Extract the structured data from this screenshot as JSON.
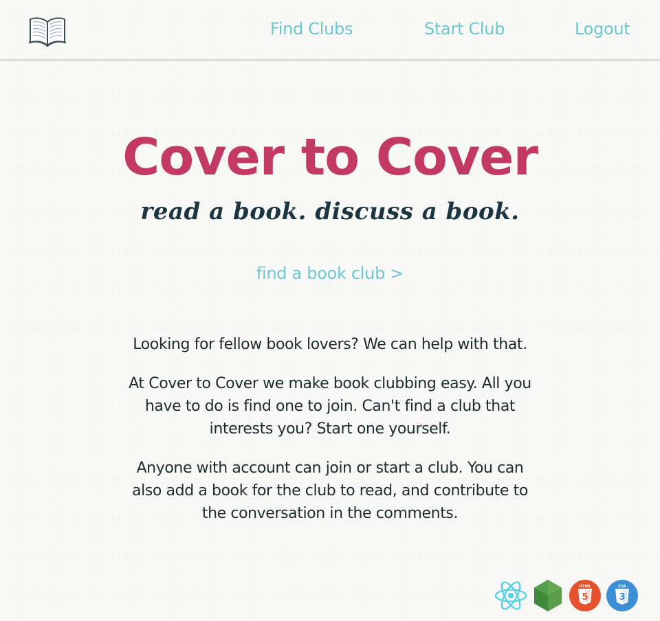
{
  "header": {
    "logo_icon": "open-book-icon",
    "nav": {
      "find_clubs": "Find Clubs",
      "start_club": "Start Club",
      "logout": "Logout"
    }
  },
  "hero": {
    "title": "Cover to Cover",
    "tagline": "read a book. discuss a book.",
    "cta": "find a book club >"
  },
  "about": {
    "paragraphs": [
      "Looking for fellow book lovers? We can help with that.",
      "At Cover to Cover we make book clubbing easy. All you have to do is find one to join. Can't find a club that interests you? Start one yourself.",
      "Anyone with account can join or start a club. You can also add a book for the club to read, and contribute to the conversation in the comments."
    ]
  },
  "footer": {
    "tech_icons": [
      "react-icon",
      "nodejs-icon",
      "html5-icon",
      "css3-icon"
    ],
    "html5_badge": "HTML",
    "css3_badge": "CSS"
  },
  "colors": {
    "accent_teal": "#6cc7d2",
    "title_red": "#c23a62",
    "text_dark": "#1d2b2f",
    "tagline": "#1d3540"
  }
}
